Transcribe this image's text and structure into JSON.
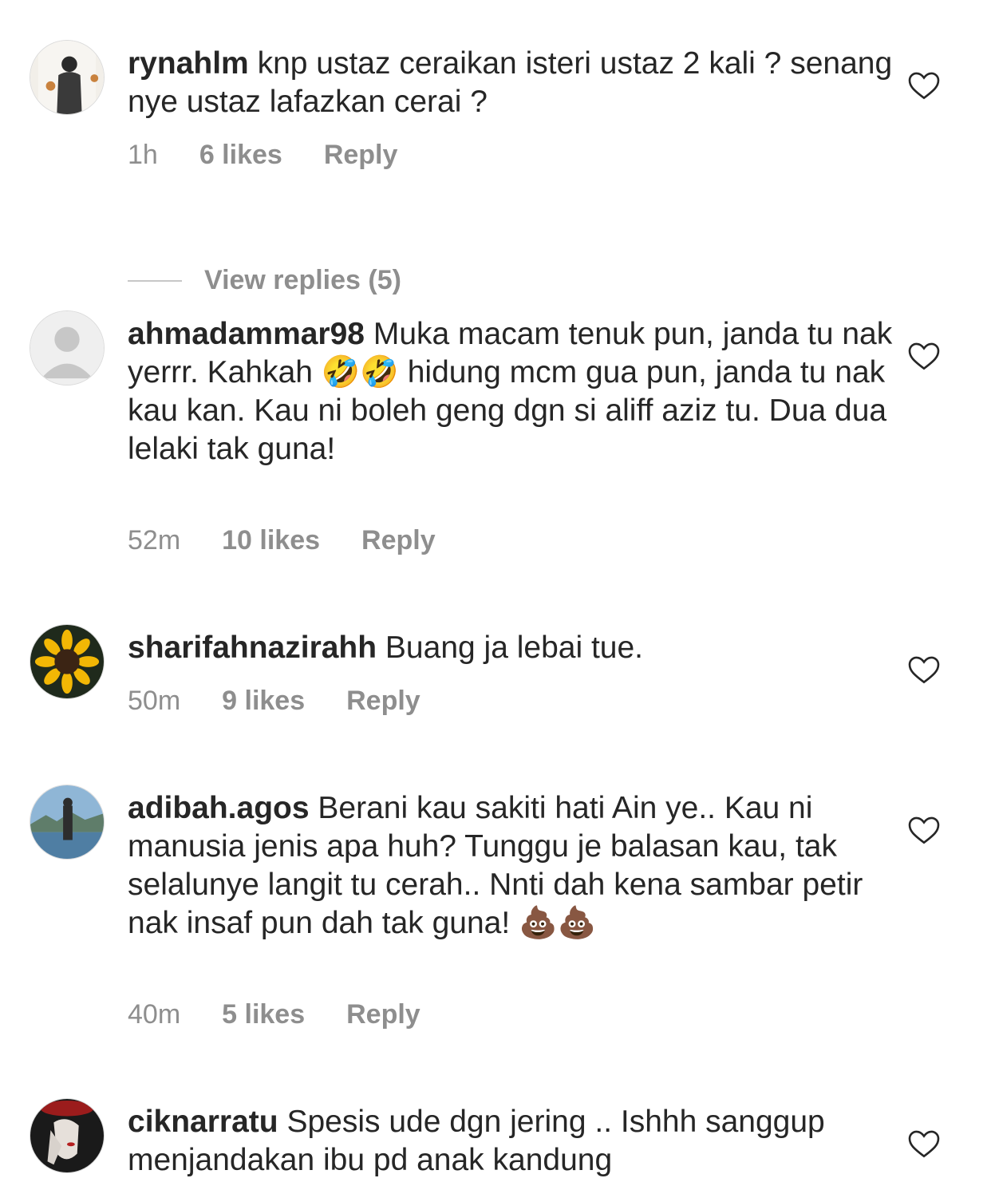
{
  "comments": [
    {
      "username": "rynahlm",
      "text": "knp ustaz ceraikan isteri ustaz 2 kali ? senang nye ustaz lafazkan cerai ?",
      "time": "1h",
      "likes": "6 likes",
      "reply": "Reply",
      "view_replies": "View replies (5)"
    },
    {
      "username": "ahmadammar98",
      "text": "Muka macam tenuk pun, janda tu nak yerrr. Kahkah 🤣🤣 hidung mcm gua pun, janda tu nak kau kan. Kau ni boleh geng dgn si aliff aziz tu. Dua dua lelaki tak guna!",
      "time": "52m",
      "likes": "10 likes",
      "reply": "Reply"
    },
    {
      "username": "sharifahnazirahh",
      "text": "Buang ja lebai tue.",
      "time": "50m",
      "likes": "9 likes",
      "reply": "Reply"
    },
    {
      "username": "adibah.agos",
      "text": "Berani kau sakiti hati Ain ye.. Kau ni manusia jenis apa huh? Tunggu je balasan kau, tak selalunye langit tu cerah.. Nnti dah kena sambar petir nak insaf pun dah tak guna! 💩💩",
      "time": "40m",
      "likes": "5 likes",
      "reply": "Reply"
    },
    {
      "username": "ciknarratu",
      "text": "Spesis ude dgn jering .. Ishhh sanggup menjandakan ibu pd anak kandung"
    }
  ],
  "icons": {
    "like": "heart-outline-icon"
  },
  "colors": {
    "text": "#262626",
    "secondary": "#8e8e8e",
    "heart_stroke": "#262626"
  }
}
